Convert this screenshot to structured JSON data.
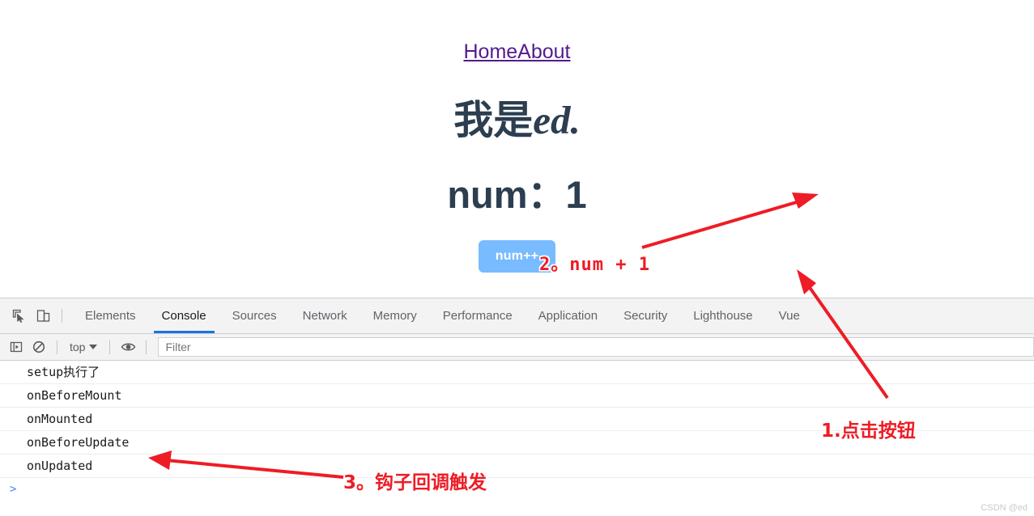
{
  "app": {
    "nav": [
      {
        "label": "Home"
      },
      {
        "label": "About"
      }
    ],
    "heading_cn": "我是",
    "heading_en": "ed.",
    "num_label": "num：1",
    "button_label": "num++",
    "link_color": "#551a8b",
    "heading_color": "#2c3e50",
    "button_color": "#79bbff"
  },
  "devtools": {
    "icons": {
      "inspect": "inspect-element-icon",
      "device": "device-toolbar-icon"
    },
    "tabs": [
      {
        "label": "Elements",
        "active": false
      },
      {
        "label": "Console",
        "active": true
      },
      {
        "label": "Sources",
        "active": false
      },
      {
        "label": "Network",
        "active": false
      },
      {
        "label": "Memory",
        "active": false
      },
      {
        "label": "Performance",
        "active": false
      },
      {
        "label": "Application",
        "active": false
      },
      {
        "label": "Security",
        "active": false
      },
      {
        "label": "Lighthouse",
        "active": false
      },
      {
        "label": "Vue",
        "active": false
      }
    ],
    "active_tab_color": "#1a73e8",
    "toolbar": {
      "sidebar_toggle": "console-sidebar-icon",
      "clear_console": "clear-console-icon",
      "context": "top",
      "eye": "live-expression-icon",
      "filter_placeholder": "Filter",
      "filter_value": ""
    },
    "console": {
      "messages": [
        {
          "text": "setup执行了"
        },
        {
          "text": "onBeforeMount"
        },
        {
          "text": "onMounted"
        },
        {
          "text": "onBeforeUpdate"
        },
        {
          "text": "onUpdated"
        }
      ],
      "prompt": ">"
    }
  },
  "annotations": {
    "step1": "1.点击按钮",
    "step2": "2。num + 1",
    "step3": "3。钩子回调触发",
    "color": "#ee1c25"
  },
  "watermark": "CSDN @ed"
}
